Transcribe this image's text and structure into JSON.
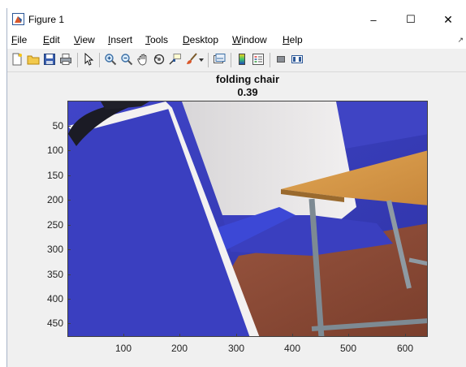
{
  "window": {
    "title": "Figure 1",
    "controls": {
      "minimize": "–",
      "maximize": "☐",
      "close": "✕"
    }
  },
  "menubar": {
    "items": [
      {
        "mnemonic": "F",
        "rest": "ile"
      },
      {
        "mnemonic": "E",
        "rest": "dit"
      },
      {
        "mnemonic": "V",
        "rest": "iew"
      },
      {
        "mnemonic": "I",
        "rest": "nsert"
      },
      {
        "mnemonic": "T",
        "rest": "ools"
      },
      {
        "mnemonic": "D",
        "rest": "esktop"
      },
      {
        "mnemonic": "W",
        "rest": "indow"
      },
      {
        "mnemonic": "H",
        "rest": "elp"
      }
    ],
    "overflow_arrow": "↗"
  },
  "toolbar": {
    "icons": [
      "new-figure-icon",
      "open-file-icon",
      "save-icon",
      "print-icon",
      "pointer-icon",
      "zoom-in-icon",
      "zoom-out-icon",
      "pan-icon",
      "rotate-3d-icon",
      "data-cursor-icon",
      "brush-icon",
      "link-plot-icon",
      "colorbar-icon",
      "legend-icon",
      "hide-plot-tools-icon",
      "show-plot-tools-icon"
    ]
  },
  "axes": {
    "title_line1": "folding chair",
    "title_line2": "0.39",
    "x_ticks": [
      "100",
      "200",
      "300",
      "400",
      "500",
      "600"
    ],
    "y_ticks": [
      "50",
      "100",
      "150",
      "200",
      "250",
      "300",
      "350",
      "400",
      "450"
    ],
    "x_range": [
      0,
      640
    ],
    "y_range": [
      0,
      480
    ]
  },
  "colors": {
    "wall_blue": "#3a3fc0",
    "floor_brown": "#8a4a36",
    "table_top": "#d79a4a",
    "board_white": "#e8e6e6"
  }
}
